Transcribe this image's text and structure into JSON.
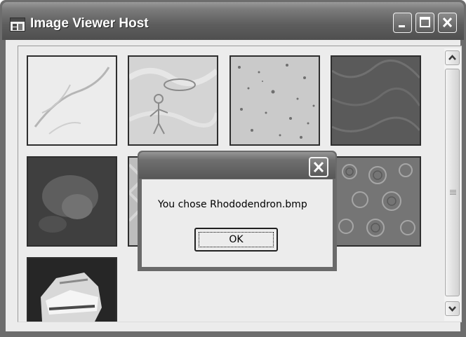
{
  "window": {
    "title": "Image Viewer Host",
    "icons": {
      "app": "app-window-icon",
      "minimize": "minimize-icon",
      "maximize": "maximize-icon",
      "close": "close-icon"
    }
  },
  "gallery": {
    "thumbnails": [
      {
        "texture": "light-sketch"
      },
      {
        "texture": "blue-lace-drawing"
      },
      {
        "texture": "speckled-stone"
      },
      {
        "texture": "dark-weave"
      },
      {
        "texture": "dark-cloud"
      },
      {
        "texture": "pastel-pattern"
      },
      {
        "texture": "hidden"
      },
      {
        "texture": "embossed-swirls"
      },
      {
        "texture": "beach-photo"
      }
    ]
  },
  "scrollbar": {
    "position": 0.0,
    "icons": {
      "up": "scroll-up-arrow-icon",
      "down": "scroll-down-arrow-icon",
      "grip": "grip-icon"
    }
  },
  "dialog": {
    "message": "You chose Rhododendron.bmp",
    "ok_label": "OK",
    "close_icon": "close-icon"
  },
  "colors": {
    "title_text": "#ffffff",
    "client_bg": "#ececec",
    "frame": "#6d6d6d"
  }
}
